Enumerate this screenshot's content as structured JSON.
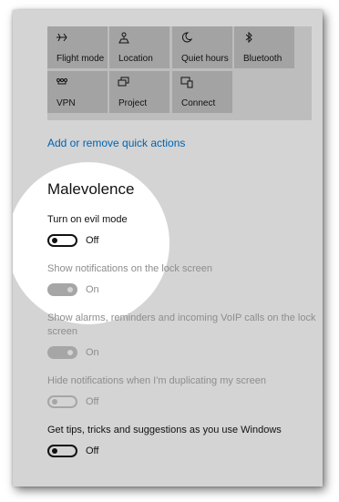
{
  "quick_actions": [
    {
      "label": "Flight mode",
      "icon": "airplane-icon"
    },
    {
      "label": "Location",
      "icon": "location-icon"
    },
    {
      "label": "Quiet hours",
      "icon": "moon-icon"
    },
    {
      "label": "Bluetooth",
      "icon": "bluetooth-icon"
    },
    {
      "label": "VPN",
      "icon": "vpn-icon"
    },
    {
      "label": "Project",
      "icon": "project-icon"
    },
    {
      "label": "Connect",
      "icon": "connect-icon"
    }
  ],
  "link_label": "Add or remove quick actions",
  "section_title": "Malevolence",
  "settings": [
    {
      "label": "Turn on evil mode",
      "state": "Off",
      "enabled": true,
      "on": false
    },
    {
      "label": "Show notifications on the lock screen",
      "state": "On",
      "enabled": false,
      "on": true
    },
    {
      "label": "Show alarms, reminders and incoming VoIP calls on the lock",
      "label_line2": "screen",
      "state": "On",
      "enabled": false,
      "on": true
    },
    {
      "label": "Hide notifications when I'm duplicating my screen",
      "state": "Off",
      "enabled": false,
      "on": false
    },
    {
      "label": "Get tips, tricks and suggestions as you use Windows",
      "state": "Off",
      "enabled": true,
      "on": false
    }
  ],
  "colors": {
    "window_background": "#d4d4d4",
    "tile_background": "#a3a3a3",
    "link": "#0063b1",
    "disabled_text": "#8d8d8d",
    "spotlight": "#ffffff"
  }
}
